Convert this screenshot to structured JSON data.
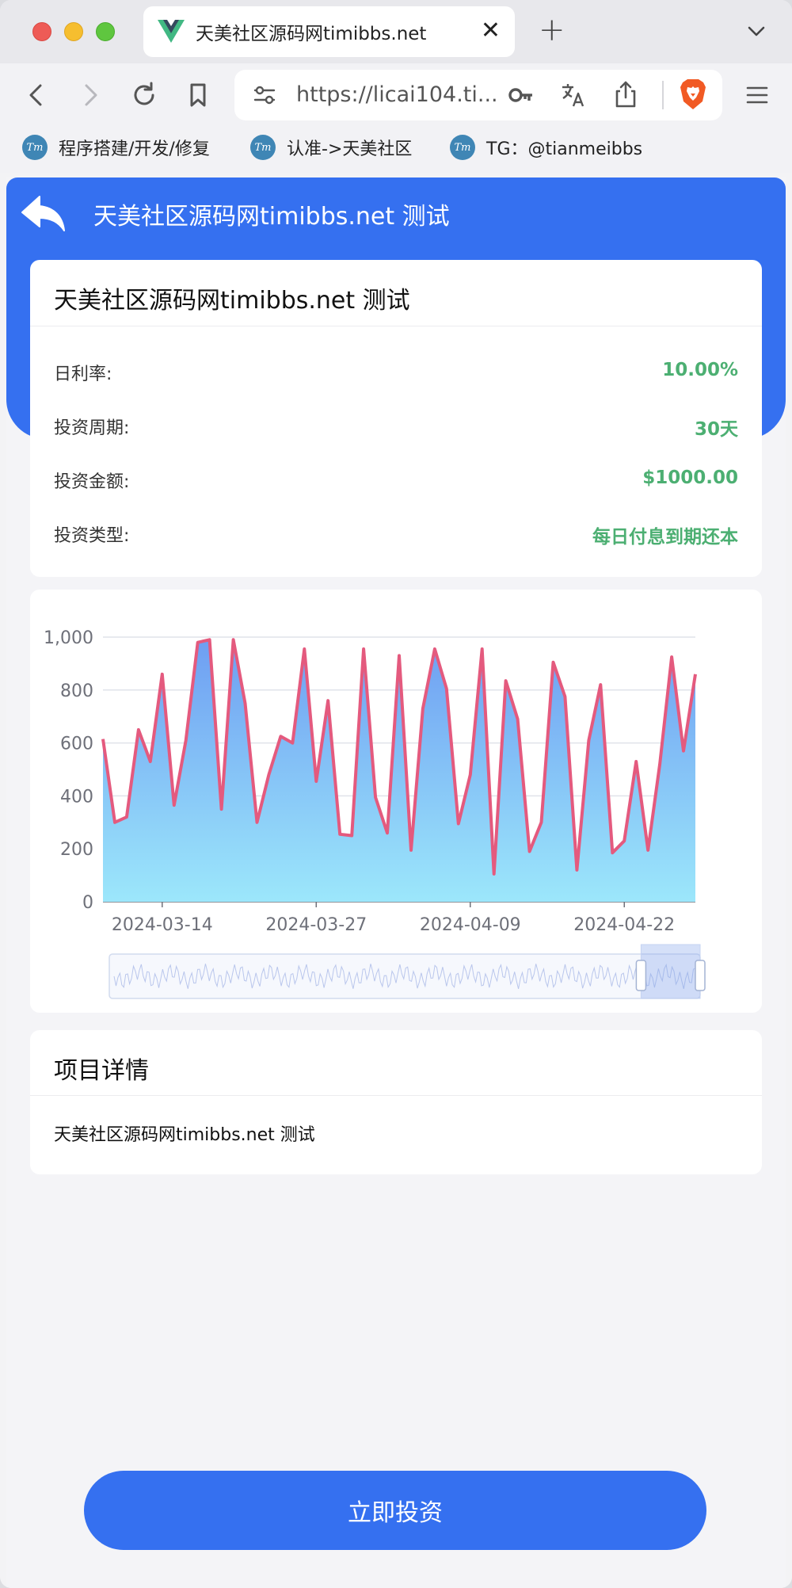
{
  "browser": {
    "tab": {
      "title": "天美社区源码网timibbs.net",
      "close_glyph": "✕",
      "favicon": "vue-logo-icon"
    },
    "new_tab_glyph": "+",
    "url": "https://licai104.ti...",
    "bookmarks": [
      {
        "label": "程序搭建/开发/修复",
        "icon_text": "Tm"
      },
      {
        "label": "认准->天美社区",
        "icon_text": "Tm"
      },
      {
        "label": "TG：@tianmeibbs",
        "icon_text": "Tm"
      }
    ]
  },
  "header": {
    "title": "天美社区源码网timibbs.net 测试"
  },
  "product": {
    "title": "天美社区源码网timibbs.net 测试",
    "rows": [
      {
        "label": "日利率:",
        "value": "10.00%"
      },
      {
        "label": "投资周期:",
        "value": "30天"
      },
      {
        "label": "投资金额:",
        "value": "$1000.00"
      },
      {
        "label": "投资类型:",
        "value": "每日付息到期还本"
      }
    ]
  },
  "details": {
    "title": "项目详情",
    "text": "天美社区源码网timibbs.net 测试"
  },
  "action": {
    "invest_label": "立即投资"
  },
  "colors": {
    "primary": "#3570f0",
    "value_green": "#4caf72",
    "line": "#e45a7e",
    "area_top": "#6e9ef2",
    "area_bottom": "#9ce7fb"
  },
  "chart_data": {
    "type": "area",
    "title": "",
    "xlabel": "",
    "ylabel": "",
    "ylim": [
      0,
      1000
    ],
    "yticks": [
      0,
      200,
      400,
      600,
      800,
      1000
    ],
    "ytick_labels": [
      "0",
      "200",
      "400",
      "600",
      "800",
      "1,000"
    ],
    "xtick_labels": [
      "2024-03-14",
      "2024-03-27",
      "2024-04-09",
      "2024-04-22"
    ],
    "xtick_index": [
      5,
      18,
      31,
      44
    ],
    "grid": true,
    "x": [
      "2024-03-09",
      "2024-03-10",
      "2024-03-11",
      "2024-03-12",
      "2024-03-13",
      "2024-03-14",
      "2024-03-15",
      "2024-03-16",
      "2024-03-17",
      "2024-03-18",
      "2024-03-19",
      "2024-03-20",
      "2024-03-21",
      "2024-03-22",
      "2024-03-23",
      "2024-03-24",
      "2024-03-25",
      "2024-03-26",
      "2024-03-27",
      "2024-03-28",
      "2024-03-29",
      "2024-03-30",
      "2024-03-31",
      "2024-04-01",
      "2024-04-02",
      "2024-04-03",
      "2024-04-04",
      "2024-04-05",
      "2024-04-06",
      "2024-04-07",
      "2024-04-08",
      "2024-04-09",
      "2024-04-10",
      "2024-04-11",
      "2024-04-12",
      "2024-04-13",
      "2024-04-14",
      "2024-04-15",
      "2024-04-16",
      "2024-04-17",
      "2024-04-18",
      "2024-04-19",
      "2024-04-20",
      "2024-04-21",
      "2024-04-22",
      "2024-04-23",
      "2024-04-24",
      "2024-04-25",
      "2024-04-26",
      "2024-04-27",
      "2024-04-28"
    ],
    "values": [
      615,
      300,
      320,
      650,
      530,
      860,
      365,
      610,
      980,
      990,
      350,
      990,
      750,
      300,
      480,
      625,
      600,
      955,
      455,
      760,
      255,
      250,
      955,
      395,
      260,
      930,
      195,
      730,
      955,
      805,
      295,
      480,
      955,
      105,
      835,
      690,
      190,
      300,
      905,
      775,
      120,
      610,
      820,
      185,
      230,
      530,
      195,
      520,
      925,
      570,
      860
    ],
    "zoom": {
      "start_fraction": 0.9,
      "end_fraction": 1.0
    }
  }
}
